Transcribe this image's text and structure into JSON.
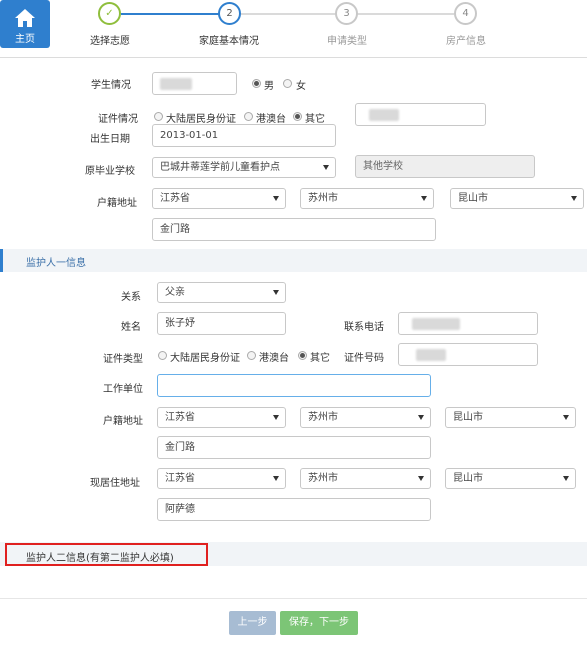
{
  "header": {
    "home_label": "主页",
    "steps": [
      {
        "num": "✓",
        "label": "选择志愿",
        "state": "done"
      },
      {
        "num": "2",
        "label": "家庭基本情况",
        "state": "active"
      },
      {
        "num": "3",
        "label": "申请类型",
        "state": "todo"
      },
      {
        "num": "4",
        "label": "房产信息",
        "state": "todo"
      }
    ]
  },
  "student": {
    "gender_label": "学生情况",
    "gender_male": "男",
    "gender_female": "女",
    "id_label": "证件情况",
    "id_opt1": "大陆居民身份证",
    "id_opt2": "港澳台",
    "id_opt3": "其它",
    "birth_label": "出生日期",
    "birth_value": "2013-01-01",
    "school_label": "原毕业学校",
    "school_value": "巴城井蒂莲学前儿童看护点",
    "school_other": "其他学校",
    "hukou_label": "户籍地址",
    "province": "江苏省",
    "city": "苏州市",
    "district": "昆山市",
    "street": "金门路"
  },
  "guardian1": {
    "title": "监护人一信息",
    "relation_label": "关系",
    "relation_value": "父亲",
    "name_label": "姓名",
    "name_value": "张子妤",
    "phone_label": "联系电话",
    "idtype_label": "证件类型",
    "id_opt1": "大陆居民身份证",
    "id_opt2": "港澳台",
    "id_opt3": "其它",
    "idnum_label": "证件号码",
    "work_label": "工作单位",
    "work_value": "",
    "hukou_label": "户籍地址",
    "hukou_province": "江苏省",
    "hukou_city": "苏州市",
    "hukou_district": "昆山市",
    "hukou_street": "金门路",
    "live_label": "现居住地址",
    "live_province": "江苏省",
    "live_city": "苏州市",
    "live_district": "昆山市",
    "live_street": "阿萨德"
  },
  "guardian2": {
    "title": "监护人二信息(有第二监护人必填)"
  },
  "footer": {
    "prev_label": "上一步",
    "next_label": "保存，下一步"
  },
  "colors": {
    "primary": "#2f7fce",
    "step_done": "#8fbe3c",
    "step_active": "#2f7fce",
    "step_todo": "#c8c8c8",
    "btn_prev": "#a7bcd3",
    "btn_next": "#7cc576",
    "highlight": "#e0201f"
  }
}
